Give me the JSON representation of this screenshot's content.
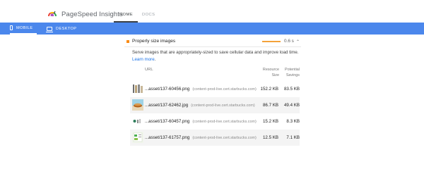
{
  "header": {
    "app_title": "PageSpeed Insights",
    "tabs": [
      {
        "label": "HOME",
        "active": true
      },
      {
        "label": "DOCS",
        "active": false
      }
    ]
  },
  "device_tabs": [
    {
      "label": "MOBILE",
      "icon": "phone-icon",
      "active": true
    },
    {
      "label": "DESKTOP",
      "icon": "desktop-icon",
      "active": false
    }
  ],
  "colors": {
    "nav_blue": "#4b87ec",
    "warning": "#fa8c16",
    "link": "#1a73e8"
  },
  "audit": {
    "title": "Properly size images",
    "savings_time": "0.6 s",
    "description": "Serve images that are appropriately-sized to save cellular data and improve load time.",
    "learn_more": "Learn more",
    "columns": {
      "url": "URL",
      "size": "Resource Size",
      "savings": "Potential Savings"
    },
    "rows": [
      {
        "file": "...asset/137-60456.png",
        "host": "(content-prod-live.cert.starbucks.com)",
        "size": "152.2 KB",
        "savings": "83.5 KB"
      },
      {
        "file": "...asset/137-62462.jpg",
        "host": "(content-prod-live.cert.starbucks.com)",
        "size": "86.7 KB",
        "savings": "49.4 KB"
      },
      {
        "file": "...asset/137-60457.png",
        "host": "(content-prod-live.cert.starbucks.com)",
        "size": "15.2 KB",
        "savings": "8.3 KB"
      },
      {
        "file": "...asset/137-61757.png",
        "host": "(content-prod-live.cert.starbucks.com)",
        "size": "12.5 KB",
        "savings": "7.1 KB"
      }
    ]
  }
}
